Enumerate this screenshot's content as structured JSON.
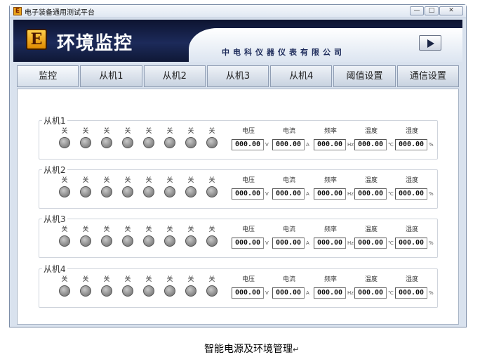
{
  "window": {
    "title": "电子装备通用测试平台",
    "app_icon": "app-logo-icon",
    "buttons": [
      "minimize-icon",
      "maximize-icon",
      "close-icon"
    ]
  },
  "banner": {
    "logo_letter": "E",
    "title": "环境监控",
    "company": "中电科仪器仪表有限公司",
    "play_icon": "play-icon"
  },
  "tabs": [
    {
      "label": "监控",
      "active": true
    },
    {
      "label": "从机1"
    },
    {
      "label": "从机2"
    },
    {
      "label": "从机3"
    },
    {
      "label": "从机4"
    },
    {
      "label": "阈值设置"
    },
    {
      "label": "通信设置"
    }
  ],
  "slaves": [
    {
      "name": "从机1",
      "lights": [
        "关",
        "关",
        "关",
        "关",
        "关",
        "关",
        "关",
        "关"
      ],
      "meters": [
        {
          "label": "电压",
          "value": "000.00",
          "unit": "V"
        },
        {
          "label": "电流",
          "value": "000.00",
          "unit": "A"
        },
        {
          "label": "频率",
          "value": "000.00",
          "unit": "Hz"
        },
        {
          "label": "温度",
          "value": "000.00",
          "unit": "℃"
        },
        {
          "label": "湿度",
          "value": "000.00",
          "unit": "%"
        }
      ]
    },
    {
      "name": "从机2",
      "lights": [
        "关",
        "关",
        "关",
        "关",
        "关",
        "关",
        "关",
        "关"
      ],
      "meters": [
        {
          "label": "电压",
          "value": "000.00",
          "unit": "V"
        },
        {
          "label": "电流",
          "value": "000.00",
          "unit": "A"
        },
        {
          "label": "频率",
          "value": "000.00",
          "unit": "Hz"
        },
        {
          "label": "温度",
          "value": "000.00",
          "unit": "℃"
        },
        {
          "label": "湿度",
          "value": "000.00",
          "unit": "%"
        }
      ]
    },
    {
      "name": "从机3",
      "lights": [
        "关",
        "关",
        "关",
        "关",
        "关",
        "关",
        "关",
        "关"
      ],
      "meters": [
        {
          "label": "电压",
          "value": "000.00",
          "unit": "V"
        },
        {
          "label": "电流",
          "value": "000.00",
          "unit": "A"
        },
        {
          "label": "频率",
          "value": "000.00",
          "unit": "Hz"
        },
        {
          "label": "温度",
          "value": "000.00",
          "unit": "℃"
        },
        {
          "label": "湿度",
          "value": "000.00",
          "unit": "%"
        }
      ]
    },
    {
      "name": "从机4",
      "lights": [
        "关",
        "关",
        "关",
        "关",
        "关",
        "关",
        "关",
        "关"
      ],
      "meters": [
        {
          "label": "电压",
          "value": "000.00",
          "unit": "V"
        },
        {
          "label": "电流",
          "value": "000.00",
          "unit": "A"
        },
        {
          "label": "频率",
          "value": "000.00",
          "unit": "Hz"
        },
        {
          "label": "温度",
          "value": "000.00",
          "unit": "℃"
        },
        {
          "label": "湿度",
          "value": "000.00",
          "unit": "%"
        }
      ]
    }
  ],
  "caption": "智能电源及环境管理"
}
